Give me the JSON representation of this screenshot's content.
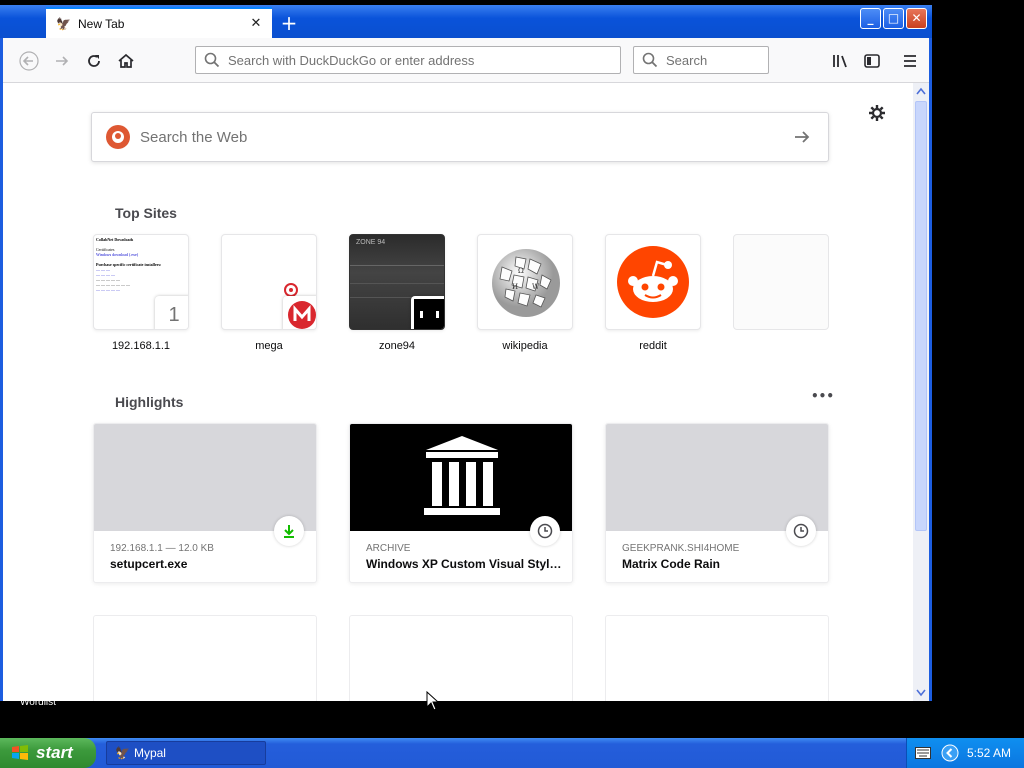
{
  "desktop": {
    "label": "Wordlist"
  },
  "window": {
    "tab_title": "New Tab",
    "new_tab_symbol": "+",
    "close_symbol": "✕",
    "minimize_symbol": "_",
    "maximize_symbol": "□"
  },
  "navbar": {
    "url_placeholder": "Search with DuckDuckGo or enter address",
    "search_placeholder": "Search"
  },
  "newtab": {
    "web_search_placeholder": "Search the Web",
    "top_sites_title": "Top Sites",
    "highlights_title": "Highlights",
    "highlights_menu": "•••",
    "top_sites": [
      {
        "label": "192.168.1.1",
        "badge": "1"
      },
      {
        "label": "mega"
      },
      {
        "label": "zone94"
      },
      {
        "label": "wikipedia"
      },
      {
        "label": "reddit"
      },
      {
        "label": ""
      }
    ],
    "top_site_preview": {
      "heading": "CollabNet Downloads",
      "line1": "Certificates",
      "line2": "Windows download (.exe)",
      "line3": "Purchase specific certificate installers:"
    },
    "zone94_caption": "ZONE 94",
    "highlights": [
      {
        "context": "192.168.1.1 — 12.0 KB",
        "title": "setupcert.exe",
        "icon": "download-icon"
      },
      {
        "context": "ARCHIVE",
        "title": "Windows XP Custom Visual Style...",
        "icon": "clock-icon"
      },
      {
        "context": "GEEKPRANK.SHI4HOME",
        "title": "Matrix Code Rain",
        "icon": "clock-icon"
      }
    ]
  },
  "taskbar": {
    "start_label": "start",
    "task_label": "Mypal",
    "clock": "5:52 AM"
  },
  "colors": {
    "xp_blue": "#0a53da",
    "start_green": "#3c9a3c",
    "reddit": "#ff4500",
    "mega": "#d9272e",
    "ddg": "#de5833",
    "download_green": "#12bc00"
  }
}
